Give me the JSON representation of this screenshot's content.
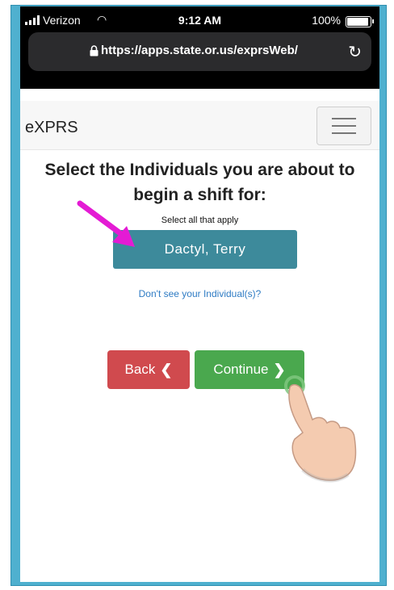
{
  "status": {
    "carrier": "Verizon",
    "time": "9:12 AM",
    "battery": "100%"
  },
  "browser": {
    "url": "https://apps.state.or.us/exprsWeb/"
  },
  "navbar": {
    "brand": "eXPRS"
  },
  "page": {
    "heading_line1": "Select the Individuals you are about to",
    "heading_line2": "begin a shift for:",
    "subtext": "Select all that apply",
    "individual": "Dactyl, Terry",
    "missing_link": "Don't see your Individual(s)?",
    "back_label": "Back",
    "continue_label": "Continue"
  },
  "colors": {
    "frame": "#4fb0cf",
    "individual_button": "#3d8a9b",
    "back_button": "#d04a4e",
    "continue_button": "#4aa84e",
    "link": "#2f7cc4",
    "annotation_arrow": "#e41bd4"
  }
}
